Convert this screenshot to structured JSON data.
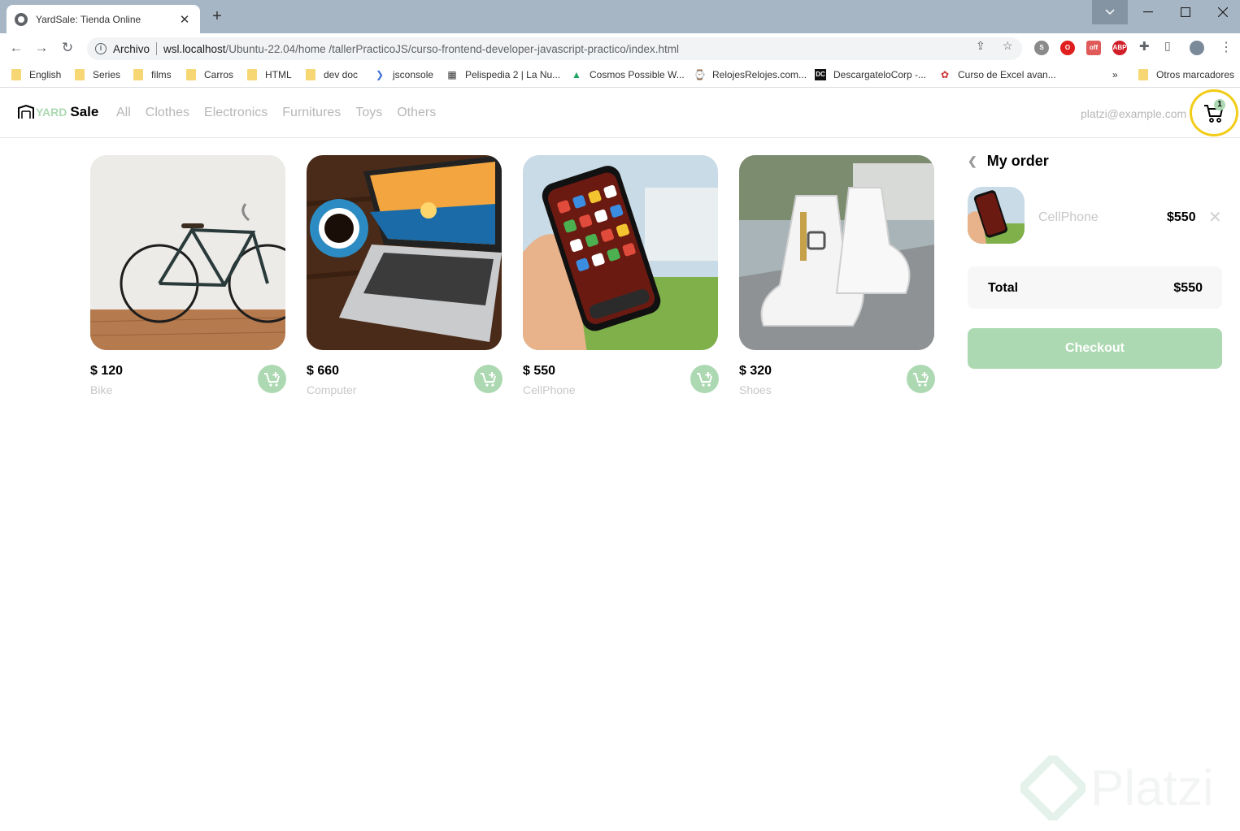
{
  "browser": {
    "tab_title": "YardSale: Tienda Online",
    "tab_close": "✕",
    "new_tab": "+",
    "url_scheme": "Archivo",
    "url_host": "wsl.localhost",
    "url_path": "/Ubuntu-22.04/home  /tallerPracticoJS/curso-frontend-developer-javascript-practico/index.html",
    "bookmarks": [
      "English",
      "Series",
      "films",
      "Carros",
      "HTML",
      "dev doc",
      "jsconsole",
      "Pelispedia 2 | La Nu...",
      "Cosmos Possible W...",
      "RelojesRelojes.com...",
      "DescargateloCorp -...",
      "Curso de Excel avan..."
    ],
    "bookmarks_more": "»",
    "other_bookmarks": "Otros marcadores"
  },
  "nav": {
    "logo_yard": "YARD",
    "logo_sale": "Sale",
    "links": [
      "All",
      "Clothes",
      "Electronics",
      "Furnitures",
      "Toys",
      "Others"
    ],
    "email": "platzi@example.com",
    "cart_count": "1"
  },
  "products": [
    {
      "price": "$ 120",
      "name": "Bike"
    },
    {
      "price": "$ 660",
      "name": "Computer"
    },
    {
      "price": "$ 550",
      "name": "CellPhone"
    },
    {
      "price": "$ 320",
      "name": "Shoes"
    }
  ],
  "order": {
    "title": "My order",
    "item_name": "CellPhone",
    "item_price": "$550",
    "total_label": "Total",
    "total_value": "$550",
    "checkout_label": "Checkout"
  },
  "watermark": "Platzi",
  "colors": {
    "accent": "#acd9b2",
    "highlight": "#f2cc17"
  }
}
